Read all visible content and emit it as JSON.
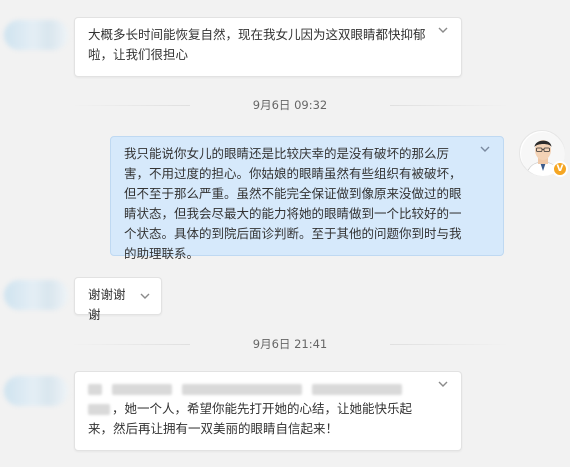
{
  "messages": [
    {
      "sender": "patient",
      "text": "大概多长时间能恢复自然，现在我女儿因为这双眼睛都快抑郁啦，让我们很担心"
    },
    {
      "sender": "doctor",
      "text": "我只能说你女儿的眼睛还是比较庆幸的是没有破坏的那么厉害，不用过度的担心。你姑娘的眼睛虽然有些组织有被破坏，但不至于那么严重。虽然不能完全保证做到像原来没做过的眼睛状态，但我会尽最大的能力将她的眼睛做到一个比较好的一个状态。具体的到院后面诊判断。至于其他的问题你到时与我的助理联系。"
    },
    {
      "sender": "patient",
      "text": "谢谢谢谢"
    },
    {
      "sender": "patient",
      "text": "，她一个人，希望你能先打开她的心结，让她能快乐起来，然后再让拥有一双美丽的眼睛自信起来！"
    }
  ],
  "timestamps": [
    "9月6日 09:32",
    "9月6日 21:41"
  ],
  "icons": {
    "menu_chevron": "chevron-down-icon",
    "verified_badge": "v-badge-icon"
  },
  "badge_text": "V",
  "colors": {
    "background": "#f2f2f2",
    "incoming_bubble": "#ffffff",
    "outgoing_bubble": "#d6e9fb",
    "badge": "#f5a623"
  }
}
